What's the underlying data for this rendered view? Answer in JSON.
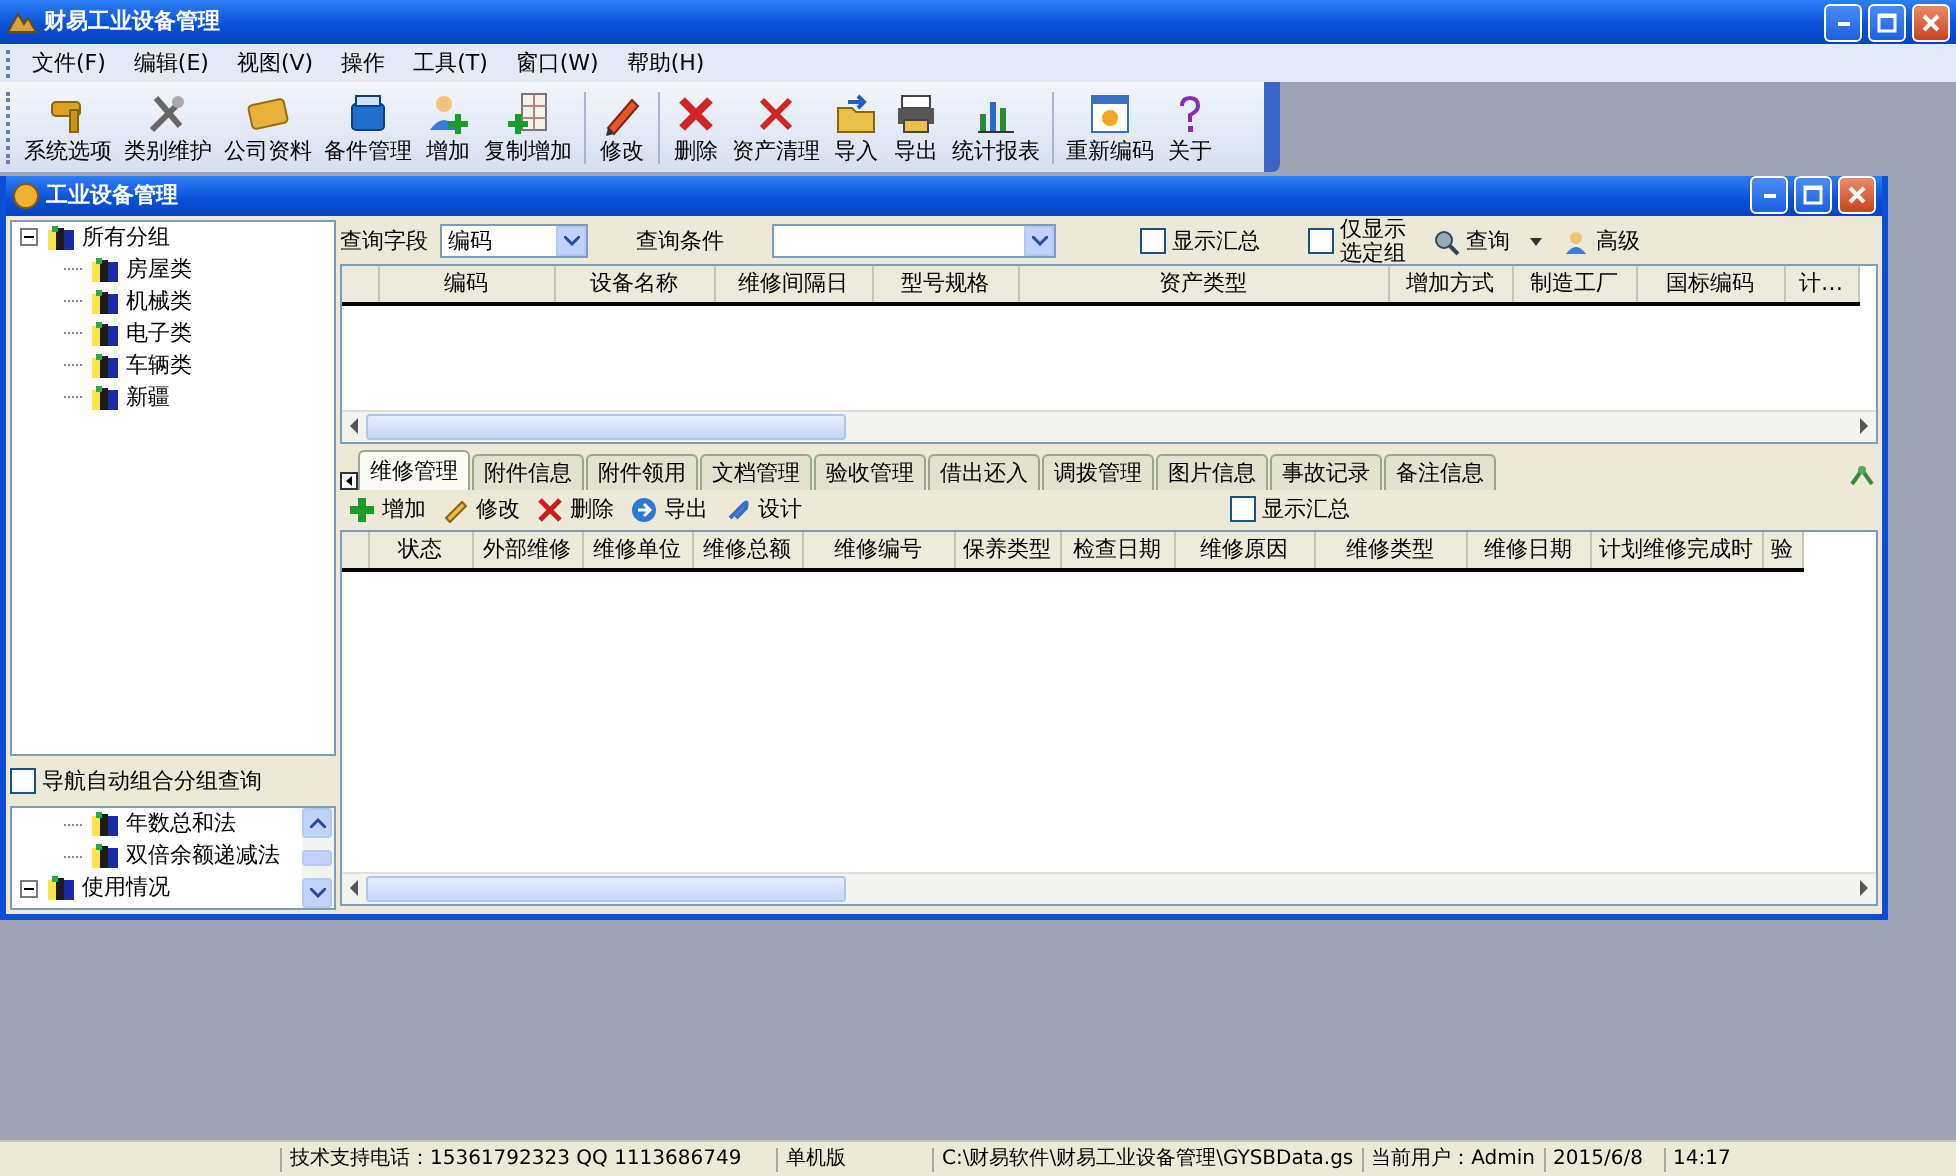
{
  "window": {
    "title": "财易工业设备管理"
  },
  "menu": [
    "文件(F)",
    "编辑(E)",
    "视图(V)",
    "操作",
    "工具(T)",
    "窗口(W)",
    "帮助(H)"
  ],
  "toolbar": [
    {
      "label": "系统选项"
    },
    {
      "label": "类别维护"
    },
    {
      "label": "公司资料"
    },
    {
      "label": "备件管理"
    },
    {
      "label": "增加"
    },
    {
      "label": "复制增加"
    },
    {
      "label": "修改"
    },
    {
      "label": "删除"
    },
    {
      "label": "资产清理"
    },
    {
      "label": "导入"
    },
    {
      "label": "导出"
    },
    {
      "label": "统计报表"
    },
    {
      "label": "重新编码"
    },
    {
      "label": "关于"
    }
  ],
  "child_window": {
    "title": "工业设备管理",
    "tree": [
      {
        "label": "所有分组",
        "expanded": true,
        "children": [
          {
            "label": "房屋类"
          },
          {
            "label": "机械类"
          },
          {
            "label": "电子类"
          },
          {
            "label": "车辆类"
          },
          {
            "label": "新疆"
          }
        ]
      }
    ],
    "nav_option": {
      "label": "导航自动组合分组查询",
      "checked": false
    },
    "nav_tree": [
      {
        "children": [
          {
            "label": "年数总和法"
          },
          {
            "label": "双倍余额递减法"
          }
        ]
      },
      {
        "label": "使用情况",
        "expanded": true
      }
    ],
    "query": {
      "field_label": "查询字段",
      "field_value": "编码",
      "condition_label": "查询条件",
      "show_summary": {
        "label": "显示汇总",
        "checked": false
      },
      "selected_only": {
        "label": "仅显示选定组",
        "checked": false
      },
      "search_button": "查询",
      "advanced_button": "高级"
    },
    "grid": {
      "columns": [
        "编码",
        "设备名称",
        "维修间隔日",
        "型号规格",
        "资产类型",
        "增加方式",
        "制造工厂",
        "国标编码",
        "计…"
      ]
    },
    "tabs": [
      {
        "label": "维修管理",
        "selected": true
      },
      {
        "label": "附件信息",
        "selected": false
      },
      {
        "label": "附件领用",
        "selected": false
      },
      {
        "label": "文档管理",
        "selected": false
      },
      {
        "label": "验收管理",
        "selected": false
      },
      {
        "label": "借出还入",
        "selected": false
      },
      {
        "label": "调拨管理",
        "selected": false
      },
      {
        "label": "图片信息",
        "selected": false
      },
      {
        "label": "事故记录",
        "selected": false
      },
      {
        "label": "备注信息",
        "selected": false
      }
    ],
    "detail_toolbar": [
      {
        "label": "增加"
      },
      {
        "label": "修改"
      },
      {
        "label": "删除"
      },
      {
        "label": "导出"
      },
      {
        "label": "设计"
      }
    ],
    "detail_summary": {
      "label": "显示汇总",
      "checked": false
    },
    "detail_grid": {
      "columns": [
        "状态",
        "外部维修",
        "维修单位",
        "维修总额",
        "维修编号",
        "保养类型",
        "检查日期",
        "维修原因",
        "维修类型",
        "维修日期",
        "计划维修完成时",
        "验"
      ]
    }
  },
  "status_bar": [
    "技术支持电话：15361792323 QQ 1113686749",
    "单机版",
    "C:\\财易软件\\财易工业设备管理\\GYSBData.gs",
    "当前用户：Admin",
    "2015/6/8",
    "14:17"
  ]
}
